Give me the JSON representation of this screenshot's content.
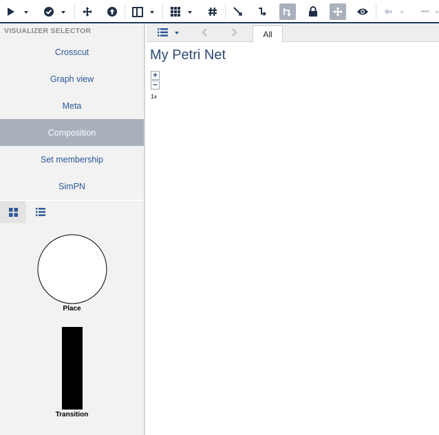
{
  "toolbar": {
    "buttons": [
      {
        "icon": "play-icon",
        "dropdown": true
      },
      {
        "icon": "check-circle-icon",
        "dropdown": true
      },
      {
        "icon": "move-arrows-icon",
        "dropdown": false
      },
      {
        "icon": "arrow-up-circle-icon",
        "dropdown": false
      },
      {
        "icon": "columns-icon",
        "dropdown": true
      },
      {
        "icon": "grid-icon",
        "dropdown": true
      },
      {
        "icon": "hash-icon",
        "dropdown": false
      },
      {
        "icon": "arrow-diagonal-icon",
        "dropdown": false
      },
      {
        "icon": "arrow-bend-icon",
        "dropdown": false
      },
      {
        "icon": "connector-icon",
        "dropdown": false,
        "active": true
      },
      {
        "icon": "lock-icon",
        "dropdown": false
      },
      {
        "icon": "pan-icon",
        "dropdown": false,
        "active": true
      },
      {
        "icon": "eye-icon",
        "dropdown": false
      },
      {
        "icon": "arrow-left-icon",
        "dropdown": true,
        "disabled": true
      },
      {
        "icon": "minus-icon",
        "dropdown": true,
        "disabled": true
      }
    ],
    "colors": {
      "icon": "#1f2f46",
      "disabled": "#c8ced6",
      "active_bg": "#a8b0bc"
    }
  },
  "visualizer_selector": {
    "title": "VISUALIZER SELECTOR",
    "items": [
      {
        "label": "Crosscut"
      },
      {
        "label": "Graph view"
      },
      {
        "label": "Meta"
      },
      {
        "label": "Composition",
        "selected": true
      },
      {
        "label": "Set membership"
      },
      {
        "label": "SimPN"
      }
    ],
    "view_toggles": [
      {
        "icon": "tiles-view-icon",
        "active": true
      },
      {
        "icon": "list-view-icon",
        "active": false
      }
    ]
  },
  "decorators": {
    "place_label": "Place",
    "transition_label": "Transition"
  },
  "main": {
    "tabs": [
      {
        "label": "All"
      }
    ],
    "title": "My Petri Net",
    "zoom": {
      "in": "+",
      "out": "−",
      "level": "1x"
    }
  }
}
